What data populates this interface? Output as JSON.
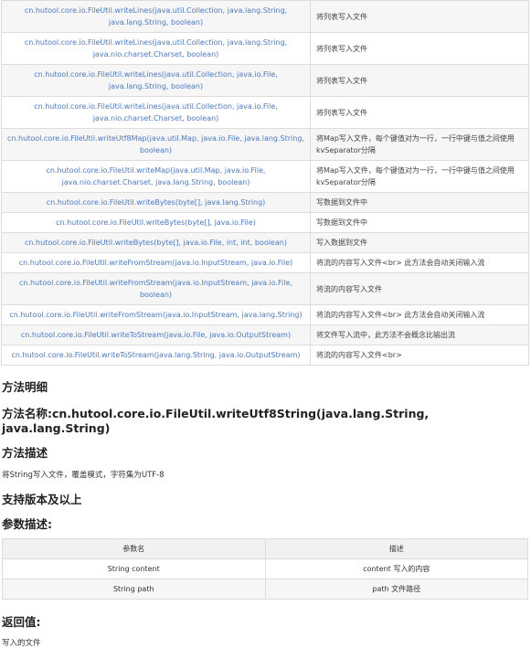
{
  "methods": [
    {
      "sig": "cn.hutool.core.io.FileUtil.writeLines(java.util.Collection, java.lang.String, java.lang.String, boolean)",
      "desc": "将列表写入文件"
    },
    {
      "sig": "cn.hutool.core.io.FileUtil.writeLines(java.util.Collection, java.lang.String, java.nio.charset.Charset, boolean)",
      "desc": "将列表写入文件"
    },
    {
      "sig": "cn.hutool.core.io.FileUtil.writeLines(java.util.Collection, java.io.File, java.lang.String, boolean)",
      "desc": "将列表写入文件"
    },
    {
      "sig": "cn.hutool.core.io.FileUtil.writeLines(java.util.Collection, java.io.File, java.nio.charset.Charset, boolean)",
      "desc": "将列表写入文件"
    },
    {
      "sig": "cn.hutool.core.io.FileUtil.writeUtf8Map(java.util.Map, java.io.File, java.lang.String, boolean)",
      "desc": "将Map写入文件，每个键值对为一行，一行中键与值之间使用kvSeparator分隔"
    },
    {
      "sig": "cn.hutool.core.io.FileUtil.writeMap(java.util.Map, java.io.File, java.nio.charset.Charset, java.lang.String, boolean)",
      "desc": "将Map写入文件，每个键值对为一行，一行中键与值之间使用kvSeparator分隔"
    },
    {
      "sig": "cn.hutool.core.io.FileUtil.writeBytes(byte[], java.lang.String)",
      "desc": "写数据到文件中"
    },
    {
      "sig": "cn.hutool.core.io.FileUtil.writeBytes(byte[], java.io.File)",
      "desc": "写数据到文件中"
    },
    {
      "sig": "cn.hutool.core.io.FileUtil.writeBytes(byte[], java.io.File, int, int, boolean)",
      "desc": "写入数据到文件"
    },
    {
      "sig": "cn.hutool.core.io.FileUtil.writeFromStream(java.io.InputStream, java.io.File)",
      "desc": "将流的内容写入文件<br> 此方法会自动关闭输入流"
    },
    {
      "sig": "cn.hutool.core.io.FileUtil.writeFromStream(java.io.InputStream, java.io.File, boolean)",
      "desc": "将流的内容写入文件"
    },
    {
      "sig": "cn.hutool.core.io.FileUtil.writeFromStream(java.io.InputStream, java.lang.String)",
      "desc": "将流的内容写入文件<br> 此方法会自动关闭输入流"
    },
    {
      "sig": "cn.hutool.core.io.FileUtil.writeToStream(java.io.File, java.io.OutputStream)",
      "desc": "将文件写入流中，此方法不会概念比输出流"
    },
    {
      "sig": "cn.hutool.core.io.FileUtil.writeToStream(java.lang.String, java.io.OutputStream)",
      "desc": "将流的内容写入文件<br>"
    }
  ],
  "detail": {
    "heading": "方法明细",
    "name_line": "方法名称:cn.hutool.core.io.FileUtil.writeUtf8String(java.lang.String, java.lang.String)",
    "desc_heading": "方法描述",
    "desc_text": "将String写入文件，覆盖模式，字符集为UTF-8",
    "version_heading": "支持版本及以上",
    "params_heading": "参数描述:",
    "params_headers": [
      "参数名",
      "描述"
    ],
    "params": [
      {
        "name": "String content",
        "desc": "content 写入的内容"
      },
      {
        "name": "String path",
        "desc": "path 文件路径"
      }
    ],
    "return_heading": "返回值:",
    "return_text": "写入的文件"
  }
}
